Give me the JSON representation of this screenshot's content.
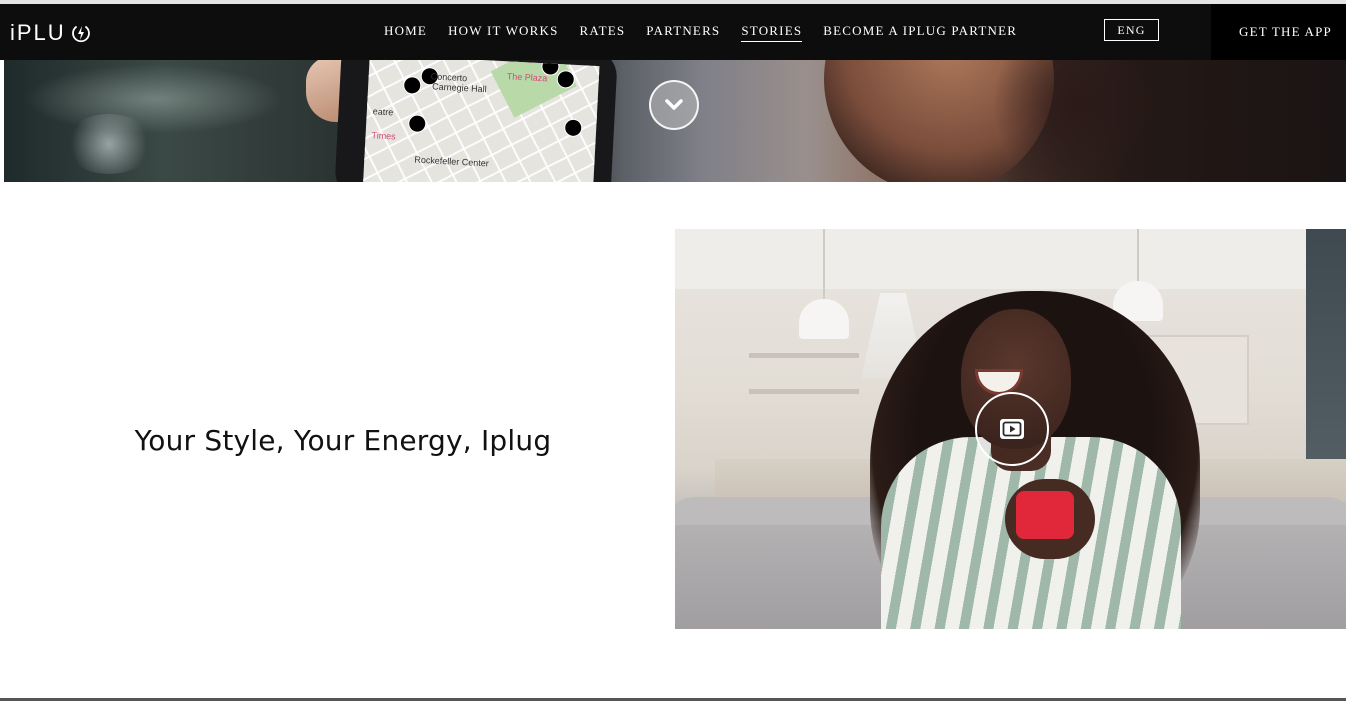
{
  "brand": {
    "logo_text": "iPLU",
    "logo_icon": "power-bolt-icon"
  },
  "nav": {
    "items": [
      {
        "label": "HOME"
      },
      {
        "label": "HOW IT WORKS"
      },
      {
        "label": "RATES"
      },
      {
        "label": "PARTNERS"
      },
      {
        "label": "STORIES",
        "active": true
      },
      {
        "label": "BECOME A IPLUG PARTNER"
      }
    ],
    "language": "ENG",
    "cta": "GET THE APP"
  },
  "hero": {
    "scroll_icon": "chevron-down-icon",
    "map_labels": [
      "Concerto",
      "Carnegie Hall",
      "The Plaza",
      "eatre",
      "Times",
      "Rockefeller Center"
    ]
  },
  "story": {
    "title": "Your Style, Your Energy, Iplug",
    "play_icon": "play-video-icon"
  },
  "colors": {
    "navbar": "#0d0d0d",
    "cta_background": "#000000",
    "text_light": "#ffffff",
    "title_text": "#111111"
  }
}
